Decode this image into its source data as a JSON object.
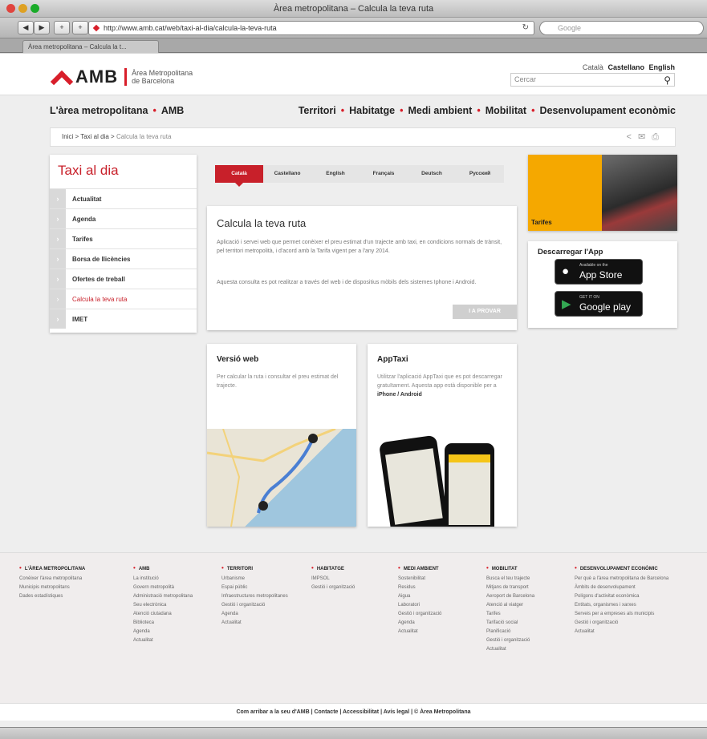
{
  "window": {
    "title": "Àrea metropolitana – Calcula la teva ruta"
  },
  "browser": {
    "url": "http://www.amb.cat/web/taxi-al-dia/calcula-la-teva-ruta",
    "search_placeholder": "Google",
    "tab_title": "Àrea metropolitana – Calcula la t..."
  },
  "header": {
    "logo_text": "AMB",
    "logo_sub1": "Àrea Metropolitana",
    "logo_sub2": "de Barcelona",
    "lang_catala": "Català",
    "lang_castellano": "Castellano",
    "lang_english": "English",
    "search_placeholder": "Cercar"
  },
  "mainnav": {
    "left": [
      "L'àrea metropolitana",
      "AMB"
    ],
    "right": [
      "Territori",
      "Habitatge",
      "Medi ambient",
      "Mobilitat",
      "Desenvolupament econòmic"
    ]
  },
  "breadcrumb": {
    "items": [
      "Inici",
      "Taxi al dia",
      "Calcula la teva ruta"
    ]
  },
  "sidebar": {
    "title": "Taxi al dia",
    "items": [
      "Actualitat",
      "Agenda",
      "Tarifes",
      "Borsa de llicències",
      "Ofertes de treball",
      "Calcula la teva ruta",
      "IMET"
    ]
  },
  "lang_tabs": [
    "Català",
    "Castellano",
    "English",
    "Français",
    "Deutsch",
    "Русский"
  ],
  "calc": {
    "title": "Calcula la teva ruta",
    "p1": "Aplicació i servei web que permet conèixer el preu estimat d'un trajecte amb taxi, en condicions normals de trànsit, pel territori metropolità, i d'acord amb la Tarifa vigent per a l'any 2014.",
    "p2": "Aquesta consulta es pot realitzar a través del web i de dispositius mòbils dels sistemes Iphone i Android.",
    "button": "I A PROVAR"
  },
  "promo": {
    "tarifes": "Tarifes"
  },
  "apps": {
    "title": "Descarregar l'App",
    "appstore_small": "Available on the",
    "appstore_big": "App Store",
    "googleplay_small": "GET IT ON",
    "googleplay_big": "Google play"
  },
  "web_box": {
    "title": "Versió web",
    "text": "Per calcular la ruta i consultar el preu estimat del trajecte."
  },
  "apptaxi_box": {
    "title": "AppTaxi",
    "text": "Utilitzar l'aplicació AppTaxi que es pot descarregar gratuïtament. Aquesta app està disponible per a",
    "platforms": "iPhone / Android"
  },
  "footer": {
    "cols": [
      {
        "head": "L'ÀREA METROPOLITANA",
        "items": [
          "Conèixer l'àrea metropolitana",
          "Municipis metropolitans",
          "Dades estadístiques"
        ]
      },
      {
        "head": "AMB",
        "items": [
          "La institució",
          "Govern metropolità",
          "Administració metropolitana",
          "Seu electrònica",
          "Atenció ciutadana",
          "Biblioteca",
          "Agenda",
          "Actualitat"
        ]
      },
      {
        "head": "TERRITORI",
        "items": [
          "Urbanisme",
          "Espai públic",
          "Infraestructures metropolitanes",
          "Gestió i organització",
          "Agenda",
          "Actualitat"
        ]
      },
      {
        "head": "HABITATGE",
        "items": [
          "IMPSOL",
          "Gestió i organització"
        ]
      },
      {
        "head": "MEDI AMBIENT",
        "items": [
          "Sostenibilitat",
          "Residus",
          "Aigua",
          "Laboratori",
          "Gestió i organització",
          "Agenda",
          "Actualitat"
        ]
      },
      {
        "head": "MOBILITAT",
        "items": [
          "Busca el teu trajecte",
          "Mitjans de transport",
          "Aeroport de Barcelona",
          "Atenció al viatger",
          "Tarifes",
          "Tarifació social",
          "Planificació",
          "Gestió i organització",
          "Actualitat"
        ]
      },
      {
        "head": "DESENVOLUPAMENT ECONÒMIC",
        "items": [
          "Per què a l'àrea metropolitana de Barcelona",
          "Àmbits de desenvolupament",
          "Polígons d'activitat econòmica",
          "Entitats, organismes i xarxes",
          "Serveis per a empreses als municipis",
          "Gestió i organització",
          "Actualitat"
        ]
      }
    ],
    "bottom": "Com arribar a la seu d'AMB  |  Contacte  |  Accessibilitat  |  Avís legal  |  © Àrea Metropolitana"
  },
  "colors": {
    "accent": "#c8202a",
    "brand": "#d81e2a"
  }
}
